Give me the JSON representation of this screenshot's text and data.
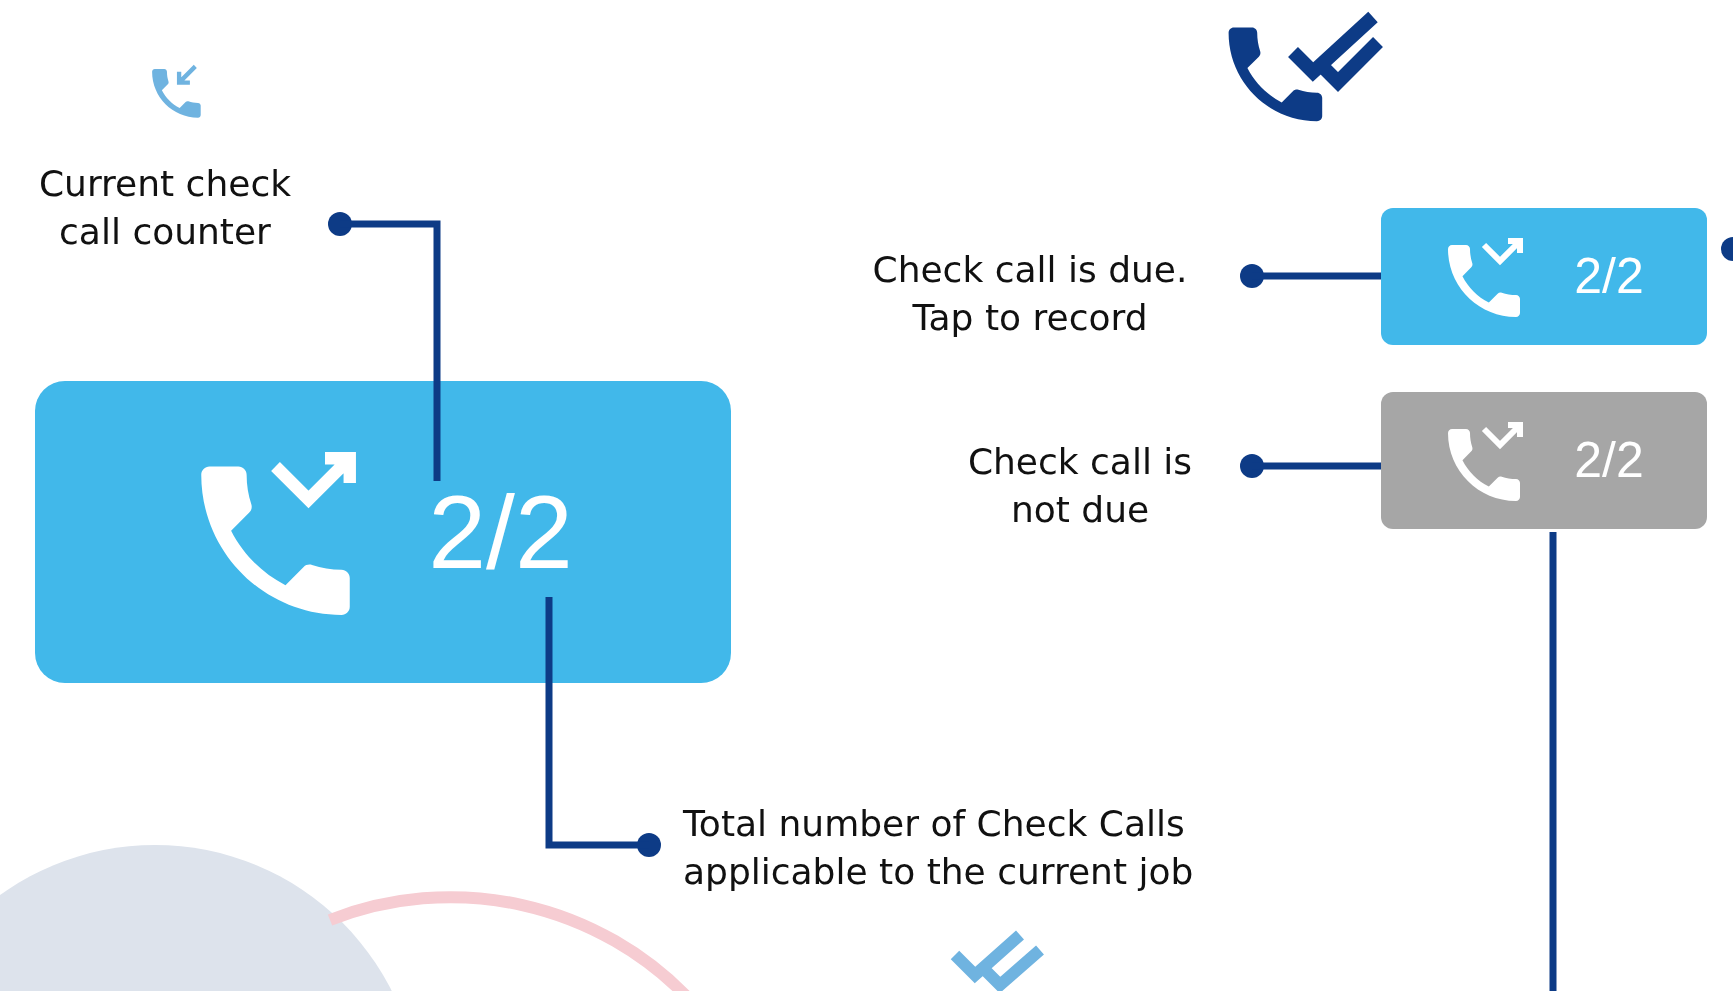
{
  "main_button": {
    "counter": "2/2",
    "due": true
  },
  "state_buttons": [
    {
      "counter": "2/2",
      "due": true
    },
    {
      "counter": "2/2",
      "due": false
    }
  ],
  "callouts": [
    "Current check call counter",
    "Check call is due. Tap to record",
    "Check call is not due",
    "Total number of Check Calls applicable to the current job"
  ]
}
